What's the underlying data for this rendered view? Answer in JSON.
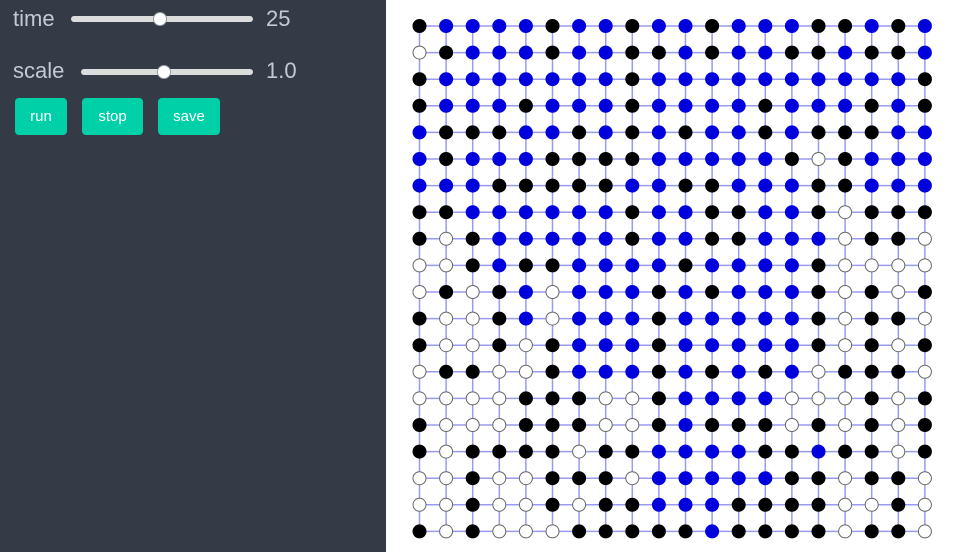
{
  "controls": {
    "time": {
      "label": "time",
      "value": "25",
      "fraction": 0.49
    },
    "scale": {
      "label": "scale",
      "value": "1.0",
      "fraction": 0.48
    }
  },
  "buttons": {
    "run": "run",
    "stop": "stop",
    "save": "save"
  },
  "grid": {
    "rows": 20,
    "cols": 20,
    "colors": {
      "line": "#9a9af0",
      "black": "#000000",
      "blue": "#0000dd",
      "white": "#ffffff",
      "outline": "#666666"
    },
    "cells": [
      "KBBBBKBBKBBKBBBKKBKB",
      "WKBBBKBBKKBKBBKKBKKB",
      "KBBBBBBBKBBBBBBBBBBK",
      "KBBBKBBBKBBBBKBBBKBK",
      "BKKKBBKBKBKBBKBKKKBB",
      "BKBBBKKKKBBBBBKWKBBB",
      "BBBKKKKKBBKKBBBKKBBB",
      "KKBBBBBBKBBKKBBKWKKK",
      "KWKBBBBBKBBKKBBBWKKW",
      "WWKBKKBBBBKBBBBKWWWW",
      "WKWKBWBBBKBKBBBKWKWK",
      "KWWKBWBBBKBBBBBKWKKW",
      "KWWKWKBBBKBBBBBKWKWK",
      "WKKWWKBBBKBKBKBWKKKW",
      "WWWWKKKWWKBBBBWWWKWK",
      "KWWWKKKWWKBKKKWKWKWK",
      "KWKKKKWKKBBBBKKBKKWK",
      "WWKWWKKKWBBBBBKKWKKW",
      "WWKWWKWKKBBBKKKKWWKW",
      "KWKWWWKKKKKBKKKKWKKW"
    ]
  }
}
